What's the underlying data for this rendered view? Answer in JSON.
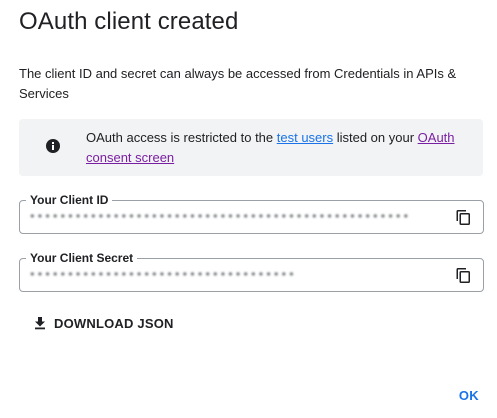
{
  "dialog": {
    "title": "OAuth client created",
    "description": "The client ID and secret can always be accessed from Credentials in APIs & Services"
  },
  "notice": {
    "icon": "info-icon",
    "text_before": "OAuth access is restricted to the ",
    "link_test_users": "test users",
    "text_middle": " listed on your ",
    "link_consent_screen": "OAuth consent screen"
  },
  "client_id": {
    "label": "Your Client ID",
    "value": "••••••••••••••••••••••••••••••••••••••••••••••••••",
    "copy_icon": "copy-icon"
  },
  "client_secret": {
    "label": "Your Client Secret",
    "value": "•••••••••••••••••••••••••••••••••••",
    "copy_icon": "copy-icon"
  },
  "actions": {
    "download_label": "DOWNLOAD JSON",
    "download_icon": "download-icon",
    "ok_label": "OK"
  },
  "colors": {
    "link_blue": "#1a73e8",
    "link_purple": "#7b1fa2",
    "notice_bg": "#f1f3f4"
  }
}
